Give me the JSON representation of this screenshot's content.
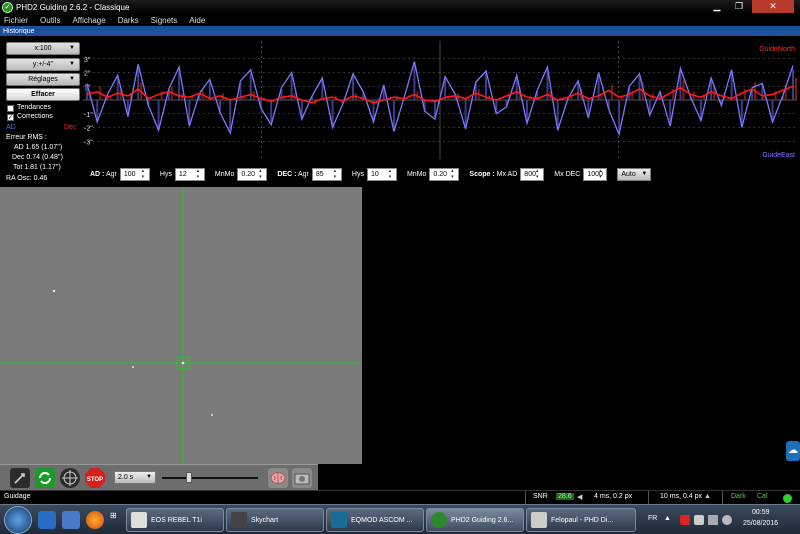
{
  "window": {
    "title": "PHD2 Guiding 2.6.2 - Classique",
    "app_icon": "phd2-logo-icon",
    "controls": [
      "minimize-icon",
      "restore-icon",
      "close-icon"
    ]
  },
  "menu": [
    "Fichier",
    "Outils",
    "Affichage",
    "Darks",
    "Signets",
    "Aide"
  ],
  "history": {
    "title": "Historique",
    "x_scale": "x:100",
    "y_scale": "y:+/-4''",
    "settings": "Réglages",
    "clear": "Effacer",
    "trends": "Tendances",
    "trends_checked": false,
    "corrections": "Corrections",
    "corrections_checked": true,
    "ra_label": "AD",
    "dec_label": "Dec",
    "rms_title": "Erreur RMS :",
    "rms_ad": "AD 1.65 (1.07'')",
    "rms_dec": "Dec 0.74 (0.48'')",
    "rms_tot": "Tot 1.81 (1.17'')",
    "ra_osc": "RA Osc: 0.46",
    "guide_north": "GuideNorth",
    "guide_east": "GuideEast",
    "colors": {
      "ra": "#7a7aff",
      "dec": "#ff1a1a",
      "ad_label": "#4a6bff",
      "dec_label": "#ff2020"
    }
  },
  "chart_data": {
    "type": "line",
    "y_ticks": [
      "3''",
      "2''",
      "1''",
      "-1''",
      "-2''",
      "-3''"
    ],
    "ylim": [
      -4,
      4
    ],
    "grid": true,
    "series": [
      {
        "name": "AD",
        "values": [
          1.2,
          -1.6,
          0.4,
          1.8,
          -1.2,
          2.6,
          -0.4,
          -2.2,
          0.8,
          2.4,
          -1.9,
          0.5,
          1.5,
          -0.9,
          -2.4,
          1.4,
          2.2,
          -0.6,
          -1.8,
          0.9,
          2.0,
          -1.4,
          0.3,
          1.6,
          -2.0,
          -0.3,
          1.9,
          0.6,
          -1.6,
          1.1,
          -2.3,
          0.2,
          2.8,
          -0.8,
          -1.4,
          1.7,
          0.4,
          -2.1,
          1.3,
          2.1,
          -1.0,
          -0.5,
          1.8,
          -1.7,
          0.7,
          2.4,
          -2.2,
          0.1,
          1.4,
          -1.3,
          2.0,
          -0.7,
          -2.5,
          1.0,
          1.9,
          -1.1,
          0.6,
          -1.9,
          2.3,
          0.2,
          -1.5,
          1.6,
          -0.4,
          2.2,
          -2.0,
          0.9,
          1.2,
          -1.6,
          0.3,
          2.5
        ]
      },
      {
        "name": "Dec",
        "values": [
          0.4,
          0.6,
          0.2,
          0.5,
          0.3,
          0.8,
          0.1,
          0.4,
          0.6,
          0.3,
          0.2,
          0.5,
          0.1,
          0.3,
          0.0,
          0.2,
          0.4,
          0.1,
          -0.1,
          0.2,
          0.3,
          0.0,
          -0.2,
          0.1,
          0.2,
          -0.1,
          0.3,
          0.1,
          -0.2,
          0.0,
          0.2,
          0.1,
          0.4,
          0.0,
          -0.1,
          0.2,
          0.3,
          0.1,
          0.5,
          0.2,
          0.0,
          0.3,
          0.6,
          0.2,
          0.1,
          0.4,
          0.0,
          0.2,
          0.5,
          0.1,
          0.3,
          0.7,
          0.2,
          0.4,
          0.8,
          0.3,
          0.1,
          0.5,
          0.9,
          0.4,
          0.2,
          0.6,
          0.3,
          0.1,
          0.5,
          0.8,
          0.3,
          0.4,
          0.7,
          1.0
        ]
      }
    ]
  },
  "controls": {
    "ad_label": "AD :",
    "ad_agr_label": "Agr",
    "ad_agr": "100",
    "ad_hys_label": "Hys",
    "ad_hys": "12",
    "ad_mnmo_label": "MnMo",
    "ad_mnmo": "0.20",
    "dec_label": "DEC :",
    "dec_agr_label": "Agr",
    "dec_agr": "85",
    "dec_hys_label": "Hys",
    "dec_hys": "10",
    "dec_mnmo_label": "MnMo",
    "dec_mnmo": "0.20",
    "scope_label": "Scope :",
    "mx_ad_label": "Mx AD",
    "mx_ad": "800",
    "mx_dec_label": "Mx DEC",
    "mx_dec": "1000",
    "dec_mode": "Auto"
  },
  "toolbar": {
    "exposure": "2.0 s",
    "icons": [
      "usb-connect-icon",
      "loop-icon",
      "crosshair-icon",
      "stop-icon",
      "brain-icon",
      "camera-icon"
    ]
  },
  "status": {
    "mode": "Guidage",
    "snr_label": "SNR",
    "snr": "28.6",
    "ra_pulse": "4 ms, 0.2 px",
    "dec_pulse": "10 ms, 0.4 px",
    "dark": "Dark",
    "cal": "Cal"
  },
  "taskbar": {
    "tasks": [
      "EOS REBEL T1i",
      "Skychart",
      "EQMOD ASCOM ...",
      "PHD2 Guiding 2.6...",
      "Felopaul - PHD Di..."
    ],
    "time": "00:59",
    "date": "25/08/2016",
    "lang": "FR"
  }
}
